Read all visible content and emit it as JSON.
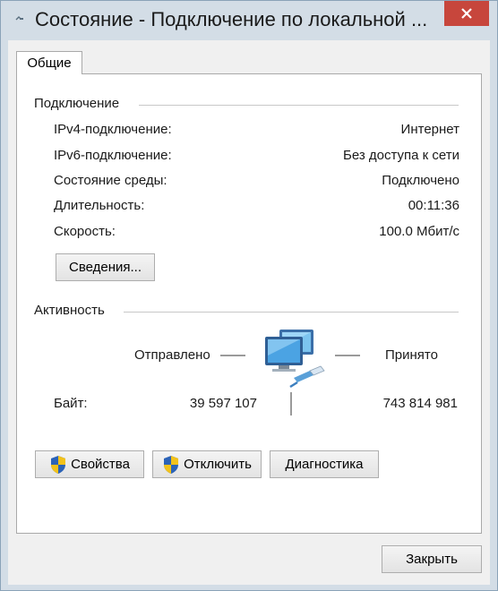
{
  "window": {
    "title": "Состояние - Подключение по локальной ...",
    "close_icon": "close-icon",
    "accent_close": "#c7463c"
  },
  "tabs": [
    {
      "label": "Общие",
      "active": true
    }
  ],
  "connection": {
    "title": "Подключение",
    "rows": [
      {
        "label": "IPv4-подключение:",
        "value": "Интернет"
      },
      {
        "label": "IPv6-подключение:",
        "value": "Без доступа к сети"
      },
      {
        "label": "Состояние среды:",
        "value": "Подключено"
      },
      {
        "label": "Длительность:",
        "value": "00:11:36"
      },
      {
        "label": "Скорость:",
        "value": "100.0 Мбит/с"
      }
    ],
    "details_button": "Сведения..."
  },
  "activity": {
    "title": "Активность",
    "sent_label": "Отправлено",
    "received_label": "Принято",
    "bytes_label": "Байт:",
    "bytes_sent": "39 597 107",
    "bytes_received": "743 814 981",
    "icon": "network-computers-icon"
  },
  "actions": {
    "properties": "Свойства",
    "disable": "Отключить",
    "diagnose": "Диагностика"
  },
  "footer": {
    "close": "Закрыть"
  }
}
